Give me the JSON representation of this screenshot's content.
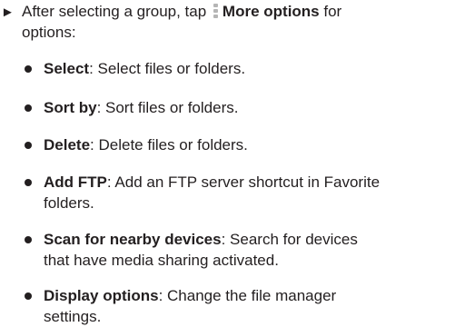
{
  "instruction": {
    "before_icon": "After selecting a group, tap",
    "icon": "more-options-kebab",
    "bold": "More options",
    "after": "for",
    "line2": "options:"
  },
  "options": [
    {
      "name": "Select",
      "desc": ": Select files or folders."
    },
    {
      "name": "Sort by",
      "desc": ": Sort files or folders."
    },
    {
      "name": "Delete",
      "desc": ": Delete files or folders."
    },
    {
      "name": "Add FTP",
      "desc": ": Add an FTP server shortcut in Favorite",
      "desc2": "folders."
    },
    {
      "name": "Scan for nearby devices",
      "desc": ": Search for devices",
      "desc2": "that have media sharing activated."
    },
    {
      "name": "Display options",
      "desc": ": Change the file manager",
      "desc2": "settings."
    }
  ]
}
